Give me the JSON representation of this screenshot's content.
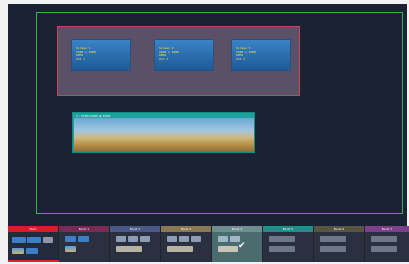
{
  "workspace": {
    "group_screens": [
      {
        "lines": [
          "Screen 1",
          "1920 x 1080",
          "60Hz",
          "Out 1"
        ]
      },
      {
        "lines": [
          "Screen 2",
          "1920 x 1080",
          "60Hz",
          "Out 2"
        ]
      },
      {
        "lines": [
          "Screen 3",
          "1920 x 1080",
          "60Hz",
          "Out 3"
        ]
      }
    ],
    "layer_strip": {
      "header": "1 : 5760x1080 @ 60Hz"
    }
  },
  "banks": [
    {
      "label": "Main",
      "color": "#d31f2b",
      "selected": true
    },
    {
      "label": "Bank 1",
      "color": "#7a2a55"
    },
    {
      "label": "Bank 2",
      "color": "#4a5a88"
    },
    {
      "label": "Bank 3",
      "color": "#8a7850"
    },
    {
      "label": "Bank 4",
      "color": "#6f8f8e"
    },
    {
      "label": "Bank 5",
      "color": "#1f8f8a"
    },
    {
      "label": "Bank 6",
      "color": "#5a5444"
    },
    {
      "label": "Bank 7",
      "color": "#7f3f8a"
    }
  ],
  "colors": {
    "canvas_bg": "#1b2233",
    "output_frame": "#3fae52",
    "group_border": "#c2485a",
    "group_fill": "#5a5067",
    "strip_teal": "#1ea19a"
  }
}
